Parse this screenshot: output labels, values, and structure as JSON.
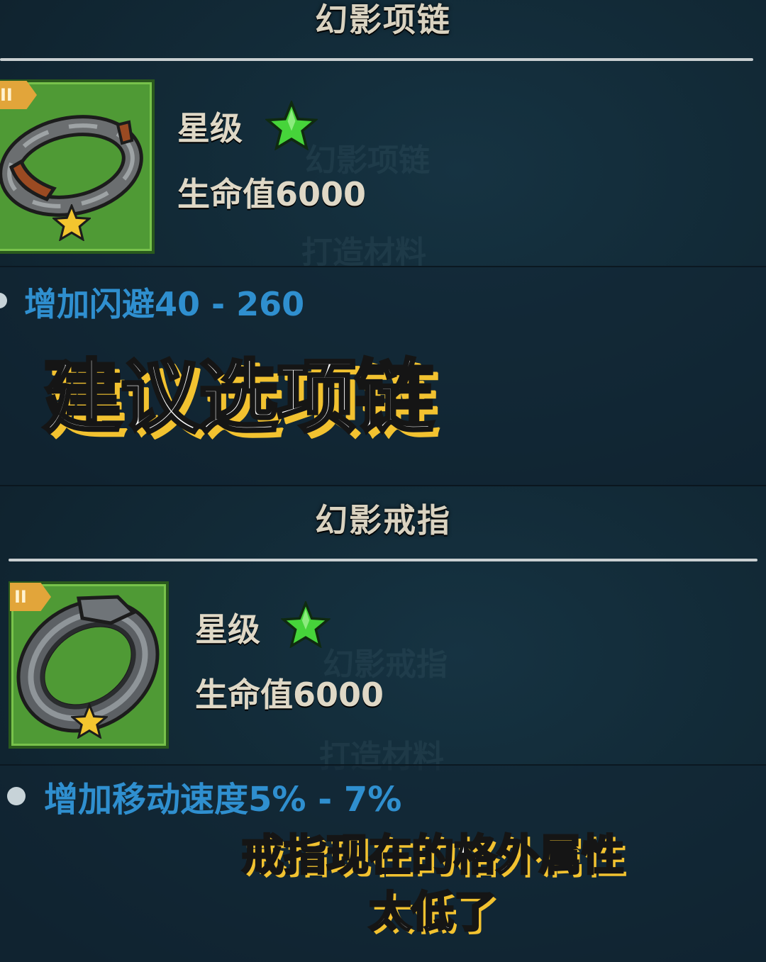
{
  "items": [
    {
      "title": "幻影项链",
      "tier": "II",
      "star_label": "星级",
      "hp": "生命值6000",
      "bonus": "增加闪避40 - 260",
      "ghost_name": "幻影项链",
      "ghost_material": "打造材料"
    },
    {
      "title": "幻影戒指",
      "tier": "II",
      "star_label": "星级",
      "hp": "生命值6000",
      "bonus": "增加移动速度5% - 7%",
      "ghost_name": "幻影戒指",
      "ghost_material": "打造材料"
    }
  ],
  "captions": {
    "recommend": "建议选项链",
    "ring_line1": "戒指现在的格外属性",
    "ring_line2": "太低了"
  },
  "colors": {
    "star_green": "#46d43a",
    "star_gold": "#f3c52f",
    "bonus_blue": "#2f8fcf",
    "caption_shadow": "#f2c230"
  },
  "icons": [
    "necklace-icon",
    "ring-icon",
    "green-star-icon",
    "gold-star-icon"
  ]
}
